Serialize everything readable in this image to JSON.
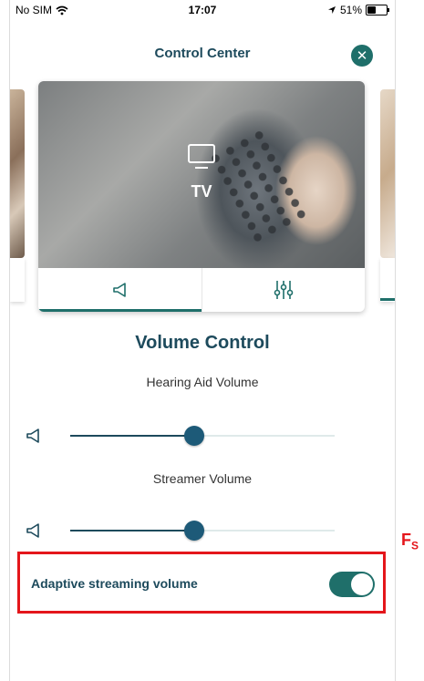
{
  "status_bar": {
    "carrier": "No SIM",
    "time": "17:07",
    "battery": "51%",
    "battery_level": 0.51
  },
  "header": {
    "title": "Control Center",
    "close_icon": "close-icon"
  },
  "program_card": {
    "label": "TV",
    "icon": "tv-icon",
    "tabs": [
      {
        "icon": "speaker-icon",
        "active": true
      },
      {
        "icon": "equalizer-icon",
        "active": false
      }
    ]
  },
  "volume_control": {
    "title": "Volume Control",
    "hearing_aid": {
      "label": "Hearing Aid Volume",
      "value": 0.47
    },
    "streamer": {
      "label": "Streamer Volume",
      "value": 0.47
    }
  },
  "adaptive_streaming": {
    "label": "Adaptive streaming volume",
    "enabled": true
  },
  "annotation": {
    "text": "F",
    "subscript": "S"
  },
  "colors": {
    "accent": "#1f6f6a",
    "title": "#1d4a5c",
    "highlight": "#e4161b"
  }
}
